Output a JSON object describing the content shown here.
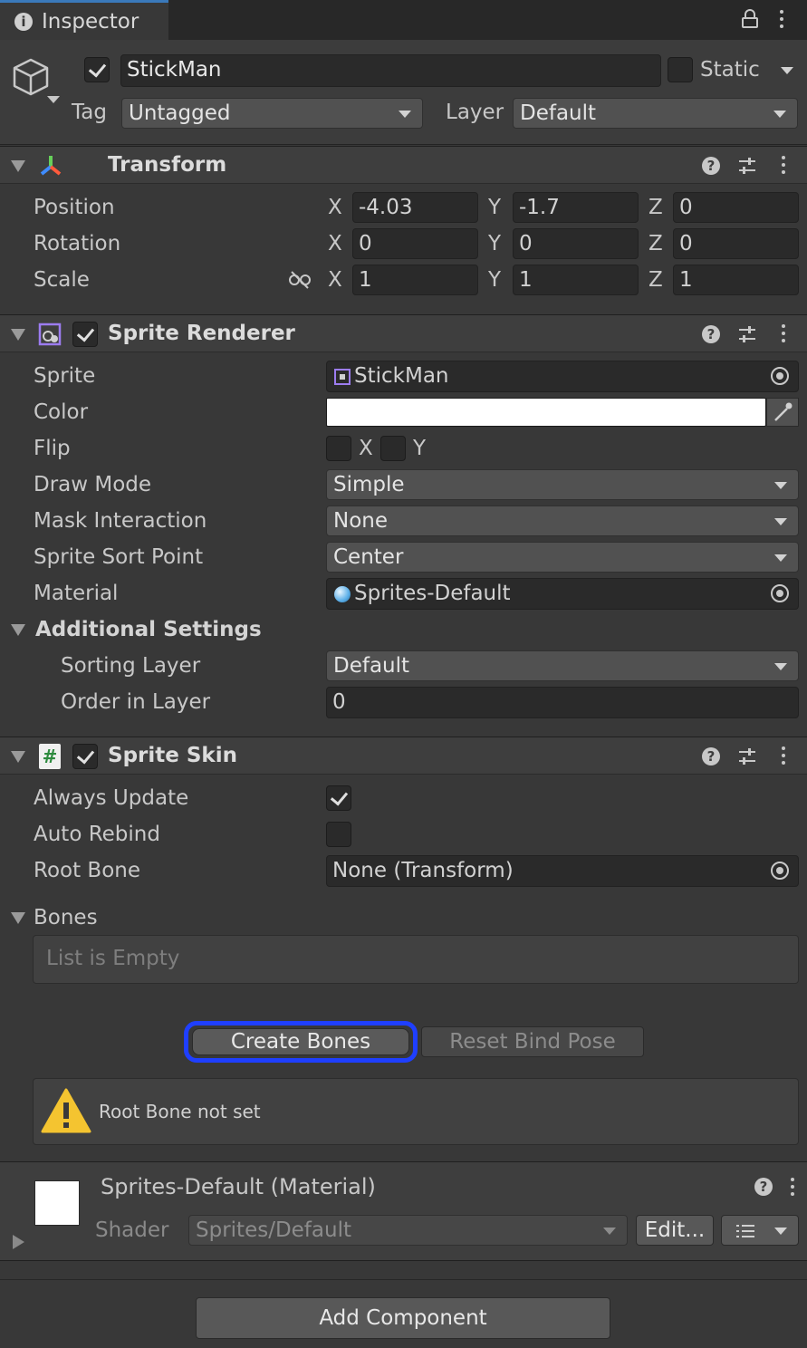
{
  "tab": {
    "title": "Inspector"
  },
  "gameobject": {
    "enabled": true,
    "name": "StickMan",
    "static_label": "Static",
    "static_checked": false,
    "tag_label": "Tag",
    "tag_value": "Untagged",
    "layer_label": "Layer",
    "layer_value": "Default"
  },
  "transform": {
    "title": "Transform",
    "position_label": "Position",
    "rotation_label": "Rotation",
    "scale_label": "Scale",
    "axis_x": "X",
    "axis_y": "Y",
    "axis_z": "Z",
    "position": {
      "x": "-4.03",
      "y": "-1.7",
      "z": "0"
    },
    "rotation": {
      "x": "0",
      "y": "0",
      "z": "0"
    },
    "scale": {
      "x": "1",
      "y": "1",
      "z": "1"
    }
  },
  "sprite_renderer": {
    "title": "Sprite Renderer",
    "enabled": true,
    "sprite_label": "Sprite",
    "sprite_value": "StickMan",
    "color_label": "Color",
    "color_value": "#ffffff",
    "flip_label": "Flip",
    "flip_x": "X",
    "flip_y": "Y",
    "draw_mode_label": "Draw Mode",
    "draw_mode_value": "Simple",
    "mask_label": "Mask Interaction",
    "mask_value": "None",
    "sort_point_label": "Sprite Sort Point",
    "sort_point_value": "Center",
    "material_label": "Material",
    "material_value": "Sprites-Default",
    "additional_label": "Additional Settings",
    "sorting_layer_label": "Sorting Layer",
    "sorting_layer_value": "Default",
    "order_label": "Order in Layer",
    "order_value": "0"
  },
  "sprite_skin": {
    "title": "Sprite Skin",
    "enabled": true,
    "always_update_label": "Always Update",
    "always_update": true,
    "auto_rebind_label": "Auto Rebind",
    "auto_rebind": false,
    "root_bone_label": "Root Bone",
    "root_bone_value": "None (Transform)",
    "bones_label": "Bones",
    "bones_empty": "List is Empty",
    "create_bones": "Create Bones",
    "reset_bind_pose": "Reset Bind Pose",
    "warning": "Root Bone not set"
  },
  "material": {
    "title": "Sprites-Default (Material)",
    "shader_label": "Shader",
    "shader_value": "Sprites/Default",
    "edit_label": "Edit..."
  },
  "add_component": "Add Component",
  "colors": {
    "background": "#383838",
    "header": "#3e3e3e",
    "field": "#2a2a2a",
    "highlight": "#1f3fff",
    "warning": "#f4c430"
  }
}
